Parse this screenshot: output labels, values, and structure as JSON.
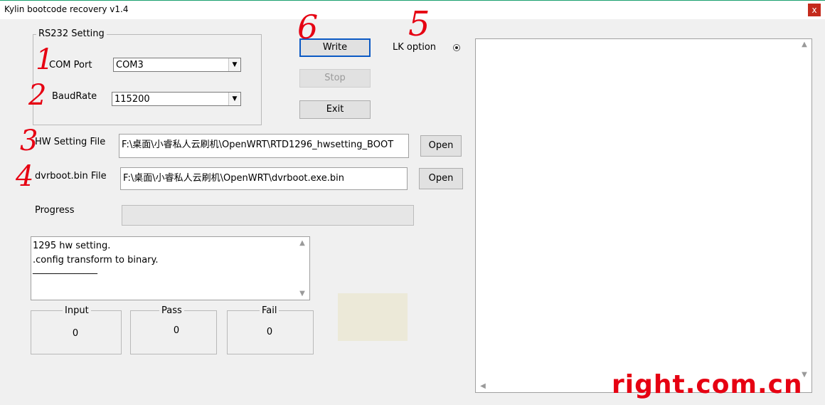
{
  "window": {
    "title": "Kylin bootcode recovery v1.4",
    "close_glyph": "x"
  },
  "rs232": {
    "group_label": "RS232 Setting",
    "com_port_label": "COM Port",
    "com_port_value": "COM3",
    "baudrate_label": "BaudRate",
    "baudrate_value": "115200"
  },
  "buttons": {
    "write": "Write",
    "stop": "Stop",
    "exit": "Exit",
    "open_hw": "Open",
    "open_dvr": "Open"
  },
  "lk_option": {
    "label": "LK option",
    "selected": true
  },
  "files": {
    "hw_label": "HW Setting File",
    "hw_value": "F:\\桌面\\小睿私人云刷机\\OpenWRT\\RTD1296_hwsetting_BOOT",
    "dvr_label": "dvrboot.bin File",
    "dvr_value": "F:\\桌面\\小睿私人云刷机\\OpenWRT\\dvrboot.exe.bin"
  },
  "progress": {
    "label": "Progress",
    "value": 0
  },
  "status_log": {
    "lines": [
      "1295 hw setting.",
      ".config transform to binary.",
      "______________"
    ]
  },
  "counters": {
    "input": {
      "label": "Input",
      "value": "0"
    },
    "pass": {
      "label": "Pass",
      "value": "0"
    },
    "fail": {
      "label": "Fail",
      "value": "0"
    }
  },
  "colors": {
    "swatch": "#ece9d8",
    "annotation": "#e60012",
    "accent": "#0b59c4"
  },
  "annotations": [
    "1",
    "2",
    "3",
    "4",
    "5",
    "6"
  ],
  "watermark": "right.com.cn"
}
